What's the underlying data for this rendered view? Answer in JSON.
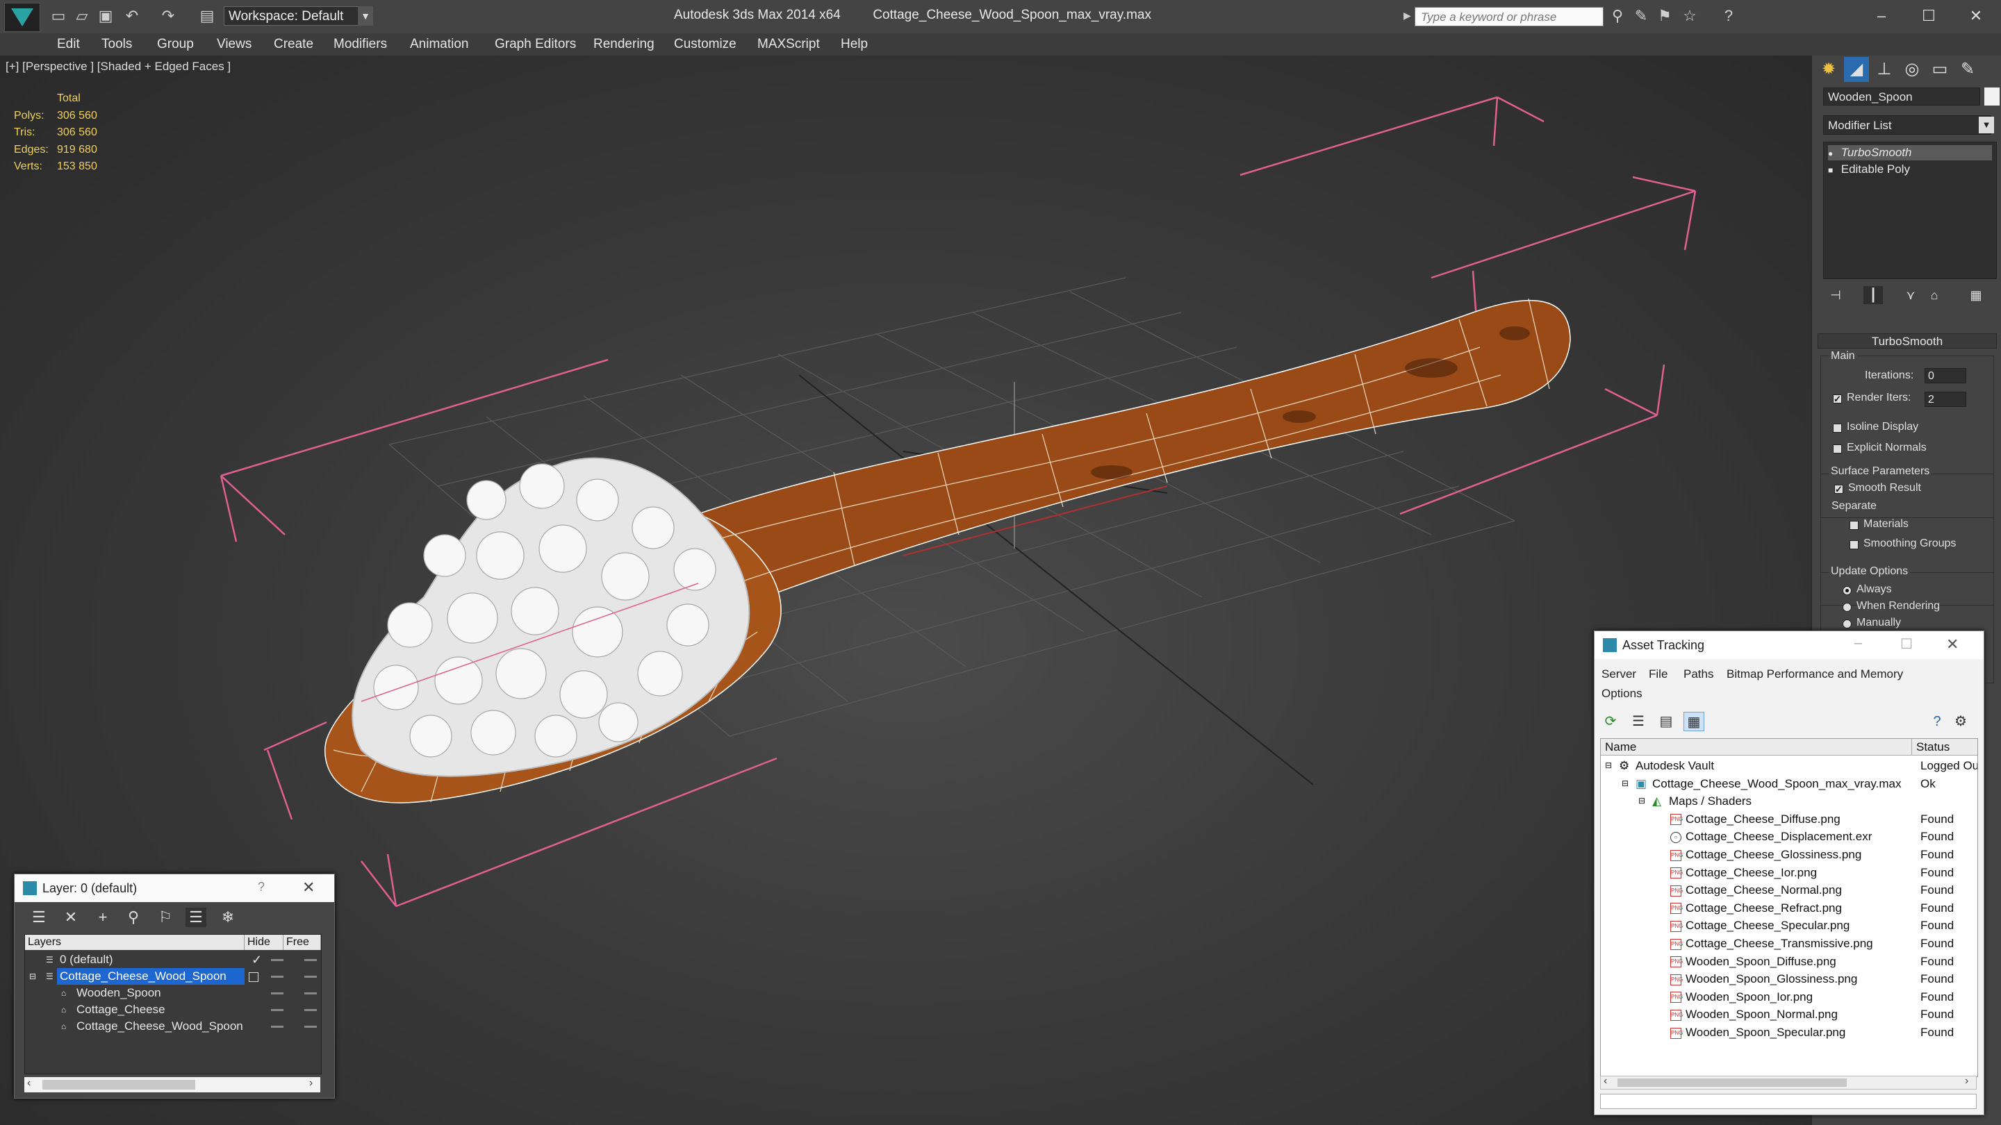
{
  "titlebar": {
    "workspace": "Workspace: Default",
    "app": "Autodesk 3ds Max  2014 x64",
    "file": "Cottage_Cheese_Wood_Spoon_max_vray.max",
    "search_placeholder": "Type a keyword or phrase"
  },
  "menu": [
    "Edit",
    "Tools",
    "Group",
    "Views",
    "Create",
    "Modifiers",
    "Animation",
    "Graph Editors",
    "Rendering",
    "Customize",
    "MAXScript",
    "Help"
  ],
  "viewport": {
    "label": "[+] [Perspective ] [Shaded + Edged Faces ]",
    "stats": {
      "header": "Total",
      "rows": [
        {
          "label": "Polys:",
          "value": "306 560"
        },
        {
          "label": "Tris:",
          "value": "306 560"
        },
        {
          "label": "Edges:",
          "value": "919 680"
        },
        {
          "label": "Verts:",
          "value": "153 850"
        }
      ]
    }
  },
  "command_panel": {
    "object_name": "Wooden_Spoon",
    "modifier_list": "Modifier List",
    "stack": [
      "TurboSmooth",
      "Editable Poly"
    ],
    "turbosmooth": {
      "title": "TurboSmooth",
      "main": "Main",
      "iterations_label": "Iterations:",
      "iterations": "0",
      "render_iters_label": "Render Iters:",
      "render_iters": "2",
      "isoline": "Isoline Display",
      "explicit_normals": "Explicit Normals",
      "surface_params": "Surface Parameters",
      "smooth_result": "Smooth Result",
      "separate": "Separate",
      "materials": "Materials",
      "smoothing_groups": "Smoothing Groups",
      "update_options": "Update Options",
      "always": "Always",
      "when_rendering": "When Rendering",
      "manually": "Manually"
    }
  },
  "layer_dialog": {
    "title": "Layer: 0 (default)",
    "help": "?",
    "columns": [
      "Layers",
      "Hide",
      "Free"
    ],
    "rows": [
      {
        "name": "0 (default)",
        "indent": 0,
        "selected": false
      },
      {
        "name": "Cottage_Cheese_Wood_Spoon",
        "indent": 0,
        "selected": true
      },
      {
        "name": "Wooden_Spoon",
        "indent": 1,
        "selected": false
      },
      {
        "name": "Cottage_Cheese",
        "indent": 1,
        "selected": false
      },
      {
        "name": "Cottage_Cheese_Wood_Spoon",
        "indent": 1,
        "selected": false
      }
    ]
  },
  "asset_dialog": {
    "title": "Asset Tracking",
    "menu": [
      "Server",
      "File",
      "Paths",
      "Bitmap Performance and Memory",
      "Options"
    ],
    "columns": [
      "Name",
      "Status"
    ],
    "rows": [
      {
        "name": "Autodesk Vault",
        "status": "Logged Ou",
        "level": 0,
        "icon": "vault"
      },
      {
        "name": "Cottage_Cheese_Wood_Spoon_max_vray.max",
        "status": "Ok",
        "level": 1,
        "icon": "max"
      },
      {
        "name": "Maps / Shaders",
        "status": "",
        "level": 2,
        "icon": "maps"
      },
      {
        "name": "Cottage_Cheese_Diffuse.png",
        "status": "Found",
        "level": 3,
        "icon": "png"
      },
      {
        "name": "Cottage_Cheese_Displacement.exr",
        "status": "Found",
        "level": 3,
        "icon": "exr"
      },
      {
        "name": "Cottage_Cheese_Glossiness.png",
        "status": "Found",
        "level": 3,
        "icon": "png"
      },
      {
        "name": "Cottage_Cheese_Ior.png",
        "status": "Found",
        "level": 3,
        "icon": "png"
      },
      {
        "name": "Cottage_Cheese_Normal.png",
        "status": "Found",
        "level": 3,
        "icon": "png"
      },
      {
        "name": "Cottage_Cheese_Refract.png",
        "status": "Found",
        "level": 3,
        "icon": "png"
      },
      {
        "name": "Cottage_Cheese_Specular.png",
        "status": "Found",
        "level": 3,
        "icon": "png"
      },
      {
        "name": "Cottage_Cheese_Transmissive.png",
        "status": "Found",
        "level": 3,
        "icon": "png"
      },
      {
        "name": "Wooden_Spoon_Diffuse.png",
        "status": "Found",
        "level": 3,
        "icon": "png"
      },
      {
        "name": "Wooden_Spoon_Glossiness.png",
        "status": "Found",
        "level": 3,
        "icon": "png"
      },
      {
        "name": "Wooden_Spoon_Ior.png",
        "status": "Found",
        "level": 3,
        "icon": "png"
      },
      {
        "name": "Wooden_Spoon_Normal.png",
        "status": "Found",
        "level": 3,
        "icon": "png"
      },
      {
        "name": "Wooden_Spoon_Specular.png",
        "status": "Found",
        "level": 3,
        "icon": "png"
      }
    ]
  },
  "colors": {
    "selection_bracket": "#e06090",
    "wood": "#9a4a16",
    "cheese": "#e8e8e8",
    "stats_text": "#f0d060",
    "selection_blue": "#1e66d0"
  }
}
